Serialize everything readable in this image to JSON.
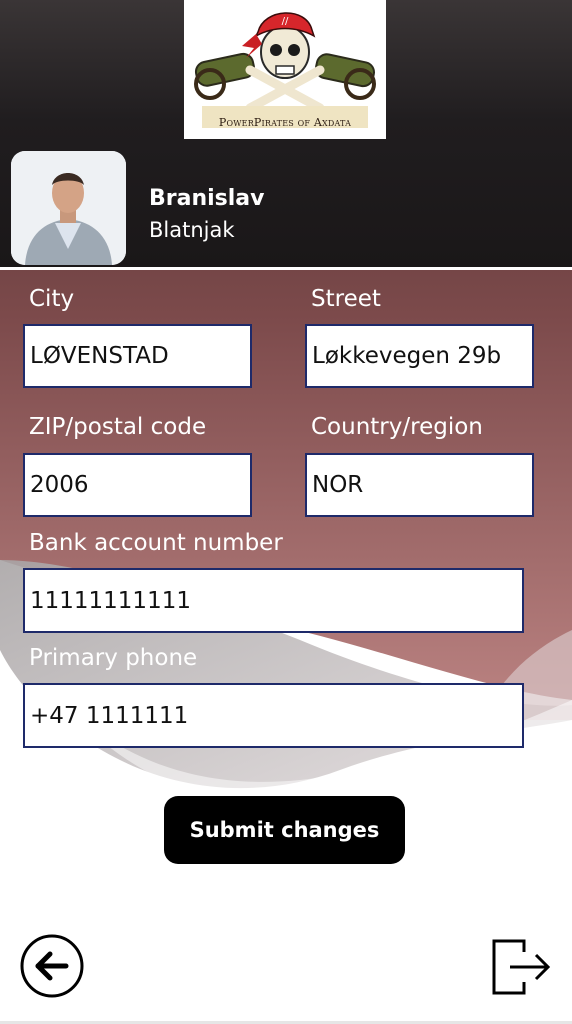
{
  "header": {
    "logo_text": "PowerPirates of Axdata",
    "logo_icon": "pirate-skull-cannons-logo",
    "user": {
      "first_name": "Branislav",
      "last_name": "Blatnjak"
    }
  },
  "form": {
    "city": {
      "label": "City",
      "value": "LØVENSTAD"
    },
    "street": {
      "label": "Street",
      "value": "Løkkevegen 29b"
    },
    "zip": {
      "label": "ZIP/postal code",
      "value": "2006"
    },
    "country": {
      "label": "Country/region",
      "value": "NOR"
    },
    "bank": {
      "label": "Bank account number",
      "value": "11111111111"
    },
    "phone": {
      "label": "Primary phone",
      "value": "+47 1111111"
    },
    "submit_label": "Submit changes"
  },
  "footer": {
    "back_icon": "arrow-left-circle-icon",
    "logout_icon": "sign-out-icon"
  },
  "colors": {
    "header_dark": "#1c191a",
    "gradient_top": "#4a2f30",
    "gradient_mid": "#a86a6a",
    "input_border": "#1e2a6a",
    "button": "#000000"
  }
}
